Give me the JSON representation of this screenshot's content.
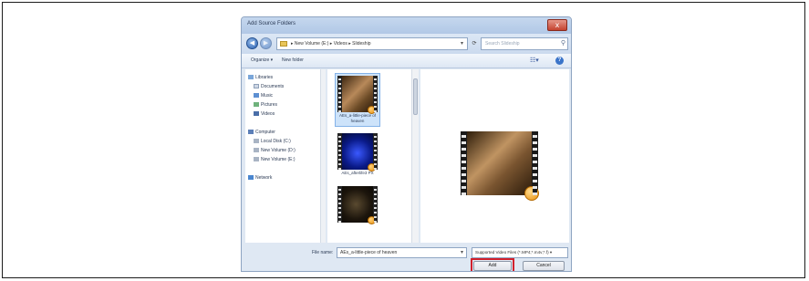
{
  "dialog": {
    "title": "Add Source Folders",
    "close_label": "x"
  },
  "address": {
    "path": "▸ New Volume (E:) ▸ Videos ▸ Slideship",
    "search_placeholder": "Search Slideship"
  },
  "toolbar": {
    "organize_label": "Organize ▾",
    "new_folder_label": "New folder",
    "views_icon": "views-icon",
    "help_icon": "help-icon"
  },
  "nav": {
    "items": [
      {
        "label": "Libraries",
        "icon": "library-icon"
      },
      {
        "label": "Documents",
        "icon": "documents-icon"
      },
      {
        "label": "Music",
        "icon": "music-icon"
      },
      {
        "label": "Pictures",
        "icon": "pictures-icon"
      },
      {
        "label": "Videos",
        "icon": "videos-icon"
      },
      {
        "label": "Computer",
        "icon": "computer-icon"
      },
      {
        "label": "Local Disk (C:)",
        "icon": "disk-icon"
      },
      {
        "label": "New Volume (D:)",
        "icon": "disk-icon"
      },
      {
        "label": "New Volume (E:)",
        "icon": "disk-icon"
      },
      {
        "label": "Network",
        "icon": "network-icon"
      }
    ]
  },
  "files": {
    "items": [
      {
        "label": "AEs_a-little-piece of heaven",
        "selected": true
      },
      {
        "label": "AEs_afterlife3 PX",
        "selected": false
      },
      {
        "label": "",
        "selected": false
      }
    ]
  },
  "footer": {
    "filename_label": "File name:",
    "filename_value": "AEs_a-little-piece of heaven",
    "filetype_value": "Supported Video Files (*.MP4;*.m4v;*.f) ▾",
    "add_label": "Add",
    "cancel_label": "Cancel"
  },
  "colors": {
    "highlight": "#d1202c",
    "selection": "#cde3fa",
    "dialog_bg": "#dfe8f3"
  }
}
